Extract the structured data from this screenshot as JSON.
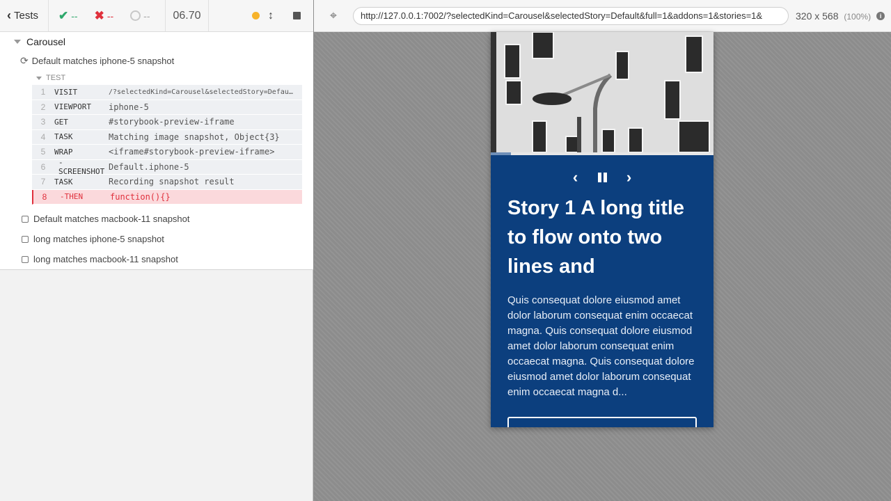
{
  "reporter": {
    "tests_label": "Tests",
    "passed": "--",
    "failed": "--",
    "pending": "--",
    "duration": "06.70",
    "suite_title": "Carousel",
    "running_test": "Default matches iphone-5 snapshot",
    "section_label": "TEST",
    "commands": [
      {
        "num": "1",
        "name": "VISIT",
        "arg": "/?selectedKind=Carousel&selectedStory=Defau…"
      },
      {
        "num": "2",
        "name": "VIEWPORT",
        "arg": "iphone-5"
      },
      {
        "num": "3",
        "name": "GET",
        "arg": "#storybook-preview-iframe"
      },
      {
        "num": "4",
        "name": "TASK",
        "arg": "Matching image snapshot, Object{3}"
      },
      {
        "num": "5",
        "name": "WRAP",
        "arg": "<iframe#storybook-preview-iframe>"
      },
      {
        "num": "6",
        "name": "-SCREENSHOT",
        "arg": "Default.iphone-5"
      },
      {
        "num": "7",
        "name": "TASK",
        "arg": "Recording snapshot result"
      },
      {
        "num": "8",
        "name": "-THEN",
        "arg": "function(){}"
      }
    ],
    "other_tests": [
      "Default matches macbook-11 snapshot",
      "long matches iphone-5 snapshot",
      "long matches macbook-11 snapshot"
    ]
  },
  "aut": {
    "url": "http://127.0.0.1:7002/?selectedKind=Carousel&selectedStory=Default&full=1&addons=1&stories=1&",
    "viewport_size": "320 x 568",
    "viewport_pct": "(100%)",
    "story": {
      "title": "Story 1 A long title to flow onto two lines and",
      "body": "Quis consequat dolore eiusmod amet dolor laborum consequat enim occaecat magna. Quis consequat dolore eiusmod amet dolor laborum consequat enim occaecat magna. Quis consequat dolore eiusmod amet dolor laborum consequat enim occaecat magna d...",
      "progress": 0.09
    }
  },
  "colors": {
    "pass": "#2ea86b",
    "fail": "#e0303c",
    "story_bg": "#0c3f7e",
    "running": "#f7b32b"
  },
  "icons": {
    "back": "chevron-left-icon",
    "pass": "check-icon",
    "fail": "x-icon",
    "pending": "spinner-icon",
    "running": "status-dot-icon",
    "scroll": "updown-arrow-icon",
    "stop": "stop-icon",
    "selector": "crosshair-icon",
    "info": "info-icon",
    "prev": "chevron-left-icon",
    "pause": "pause-icon",
    "next": "chevron-right-icon"
  }
}
